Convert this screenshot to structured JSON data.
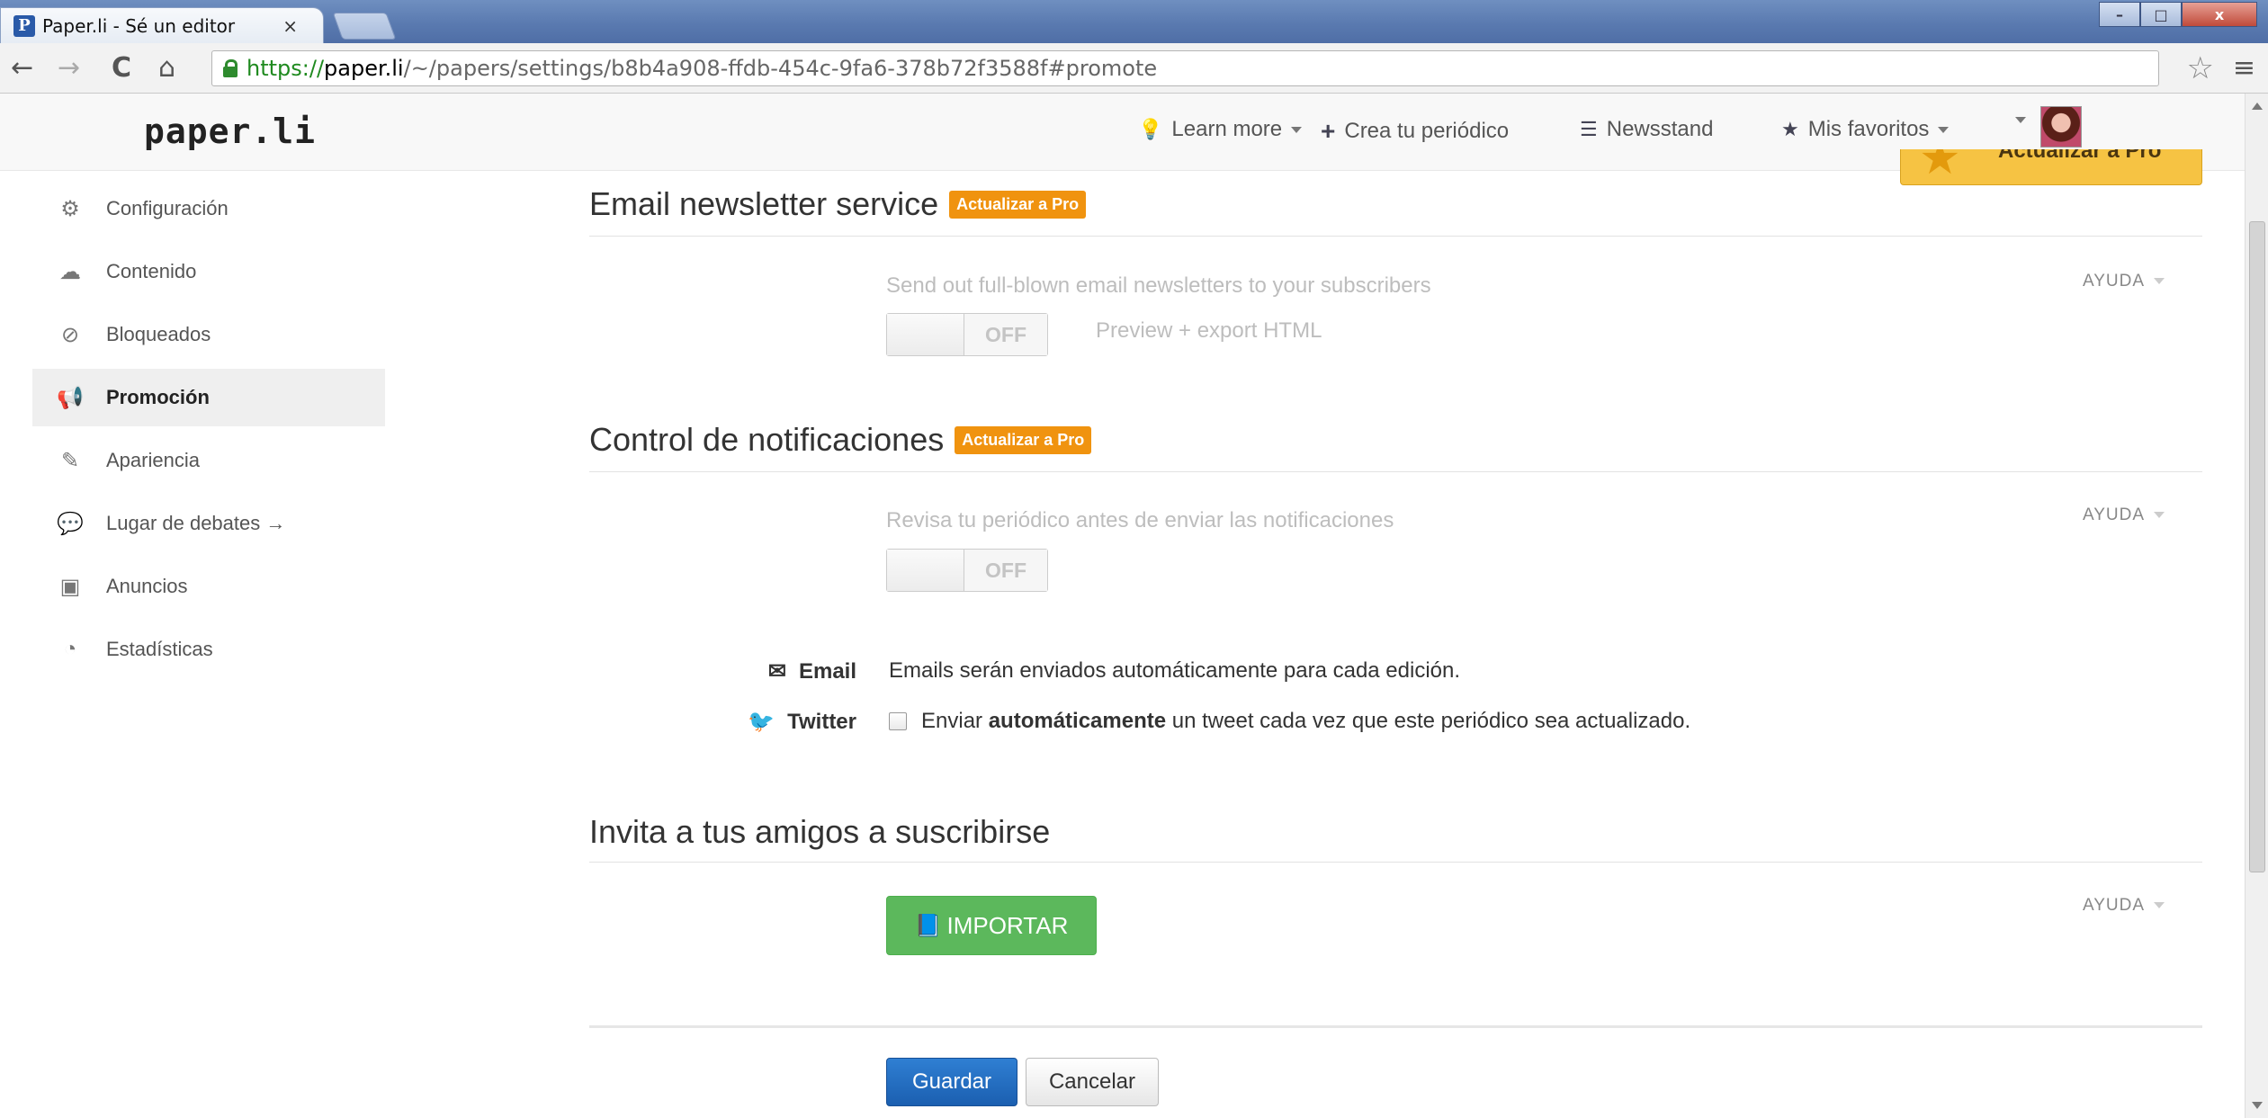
{
  "browser": {
    "tab_title": "Paper.li - Sé un editor",
    "tab_close": "×",
    "url_scheme": "https://",
    "url_host": "paper.li",
    "url_path": "/~/papers/settings/b8b4a908-ffdb-454c-9fa6-378b72f3588f#promote",
    "nav_back": "←",
    "nav_forward": "→",
    "nav_reload": "C",
    "nav_home": "⌂",
    "bookmark_star": "☆",
    "menu": "≡",
    "win_min": "–",
    "win_max": "□",
    "win_close": "x"
  },
  "header": {
    "logo": "paper.li",
    "learn_more": "Learn more",
    "crea": "Crea tu periódico",
    "newsstand": "Newsstand",
    "favoritos": "Mis favoritos",
    "pro_ribbon": "Actualizar a Pro",
    "icons": {
      "learn_more": "lightbulb-icon",
      "crea": "plus-icon",
      "newsstand": "list-icon",
      "favoritos": "star-icon"
    }
  },
  "sidebar": {
    "items": [
      {
        "label": "Configuración",
        "icon": "gear-icon",
        "glyph": "⚙"
      },
      {
        "label": "Contenido",
        "icon": "cloud-upload-icon",
        "glyph": "☁"
      },
      {
        "label": "Bloqueados",
        "icon": "ban-icon",
        "glyph": "⊘"
      },
      {
        "label": "Promoción",
        "icon": "megaphone-icon",
        "glyph": "📢"
      },
      {
        "label": "Apariencia",
        "icon": "magic-wand-icon",
        "glyph": "✎"
      },
      {
        "label": "Lugar de debates →",
        "icon": "comments-icon",
        "glyph": "💬"
      },
      {
        "label": "Anuncios",
        "icon": "money-icon",
        "glyph": "▣"
      },
      {
        "label": "Estadísticas",
        "icon": "dashboard-icon",
        "glyph": "◔"
      }
    ],
    "active_index": 3
  },
  "sections": {
    "newsletter": {
      "title": "Email newsletter service",
      "badge": "Actualizar a Pro",
      "description": "Send out full-blown email newsletters to your subscribers",
      "toggle": "OFF",
      "preview": "Preview + export HTML",
      "help": "AYUDA"
    },
    "notifications": {
      "title": "Control de notificaciones",
      "badge": "Actualizar a Pro",
      "description": "Revisa tu periódico antes de enviar las notificaciones",
      "toggle": "OFF",
      "help": "AYUDA",
      "email_label": "Email",
      "email_text": "Emails serán enviados automáticamente para cada edición.",
      "twitter_label": "Twitter",
      "twitter_text_pre": "Enviar ",
      "twitter_text_bold": "automáticamente",
      "twitter_text_post": " un tweet cada vez que este periódico sea actualizado.",
      "twitter_checked": false
    },
    "invite": {
      "title": "Invita a tus amigos a suscribirse",
      "import_button": "IMPORTAR",
      "help": "AYUDA"
    }
  },
  "actions": {
    "save": "Guardar",
    "cancel": "Cancelar"
  }
}
